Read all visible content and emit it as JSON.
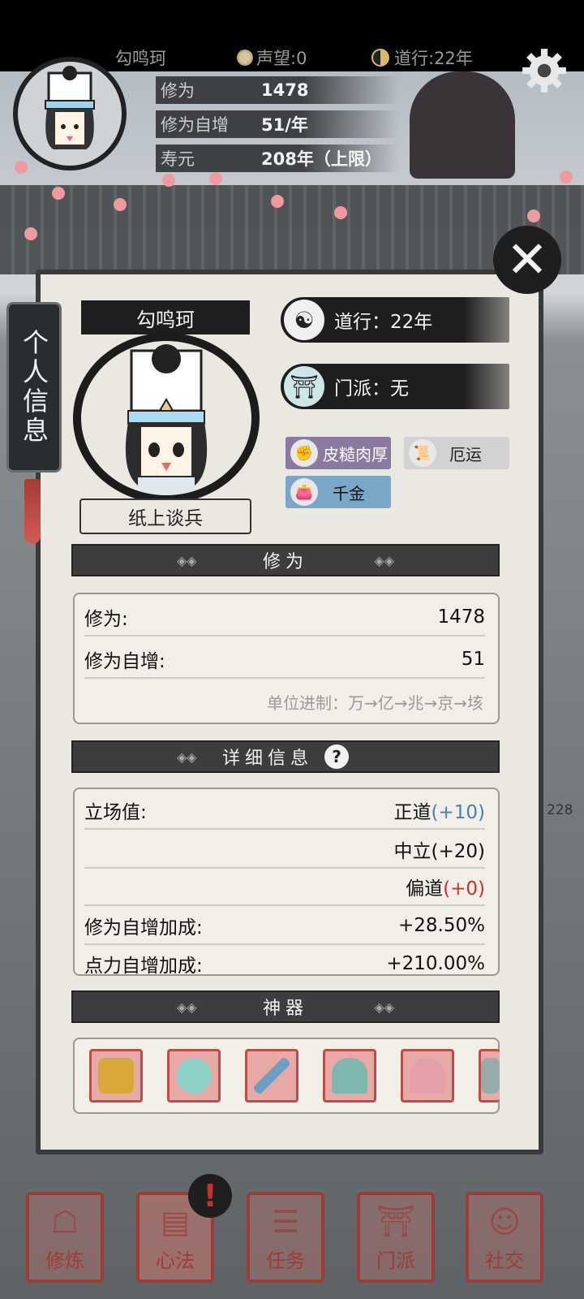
{
  "topbar": {
    "player_name": "勾鸣珂",
    "reputation": "声望:0",
    "dao_years": "道行:22年"
  },
  "header_stats": [
    {
      "label": "修为",
      "value": "1478"
    },
    {
      "label": "修为自增",
      "value": "51/年"
    },
    {
      "label": "寿元",
      "value": "208年（上限）"
    }
  ],
  "side_tab": {
    "label": "个人信息"
  },
  "profile": {
    "name": "勾鸣珂",
    "title": "纸上谈兵",
    "dao": "道行：22年",
    "sect": "门派：无",
    "traits": [
      {
        "label": "皮糙肉厚",
        "icon": "fist-icon",
        "color": "#8b7aa0"
      },
      {
        "label": "厄运",
        "icon": "scroll-icon",
        "color": "#d2d2d2"
      },
      {
        "label": "千金",
        "icon": "money-bag-icon",
        "color": "#7aa6c8"
      }
    ]
  },
  "cultivation_section": {
    "header": "修为",
    "rows": [
      {
        "label": "修为:",
        "value": "1478"
      },
      {
        "label": "修为自增:",
        "value": "51"
      }
    ],
    "unit_hint": "单位进制：万→亿→兆→京→垓"
  },
  "detail_section": {
    "header": "详细信息",
    "stance_label": "立场值:",
    "stances": [
      {
        "text": "正道",
        "bonus": "(+10)",
        "bonus_color": "#4a7fb0"
      },
      {
        "text": "中立",
        "bonus": "(+20)",
        "bonus_color": "#111111"
      },
      {
        "text": "偏道",
        "bonus": "(+0)",
        "bonus_color": "#c0332e"
      }
    ],
    "bonus_label": "修为自增加成:",
    "bonus_value": "+28.50%",
    "cut_label": "点力自增加成:",
    "cut_value": "+210.00%"
  },
  "side_number": "228",
  "artifact_section": {
    "header": "神器",
    "items": [
      {
        "name": "gauntlet-icon",
        "color": "#d8a93a"
      },
      {
        "name": "mirror-icon",
        "color": "#8fd0c8"
      },
      {
        "name": "dagger-icon",
        "color": "#6aa0c8"
      },
      {
        "name": "token-icon",
        "color": "#7fb6b0"
      },
      {
        "name": "fan-icon",
        "color": "#e4a0a8"
      },
      {
        "name": "book-icon",
        "color": "#9aa"
      }
    ]
  },
  "bottom_nav": [
    {
      "label": "修炼",
      "icon": "meditate-icon"
    },
    {
      "label": "心法",
      "icon": "book-icon"
    },
    {
      "label": "任务",
      "icon": "scroll-icon"
    },
    {
      "label": "门派",
      "icon": "sect-icon"
    },
    {
      "label": "社交",
      "icon": "social-icon"
    }
  ],
  "alert_badge": "!"
}
